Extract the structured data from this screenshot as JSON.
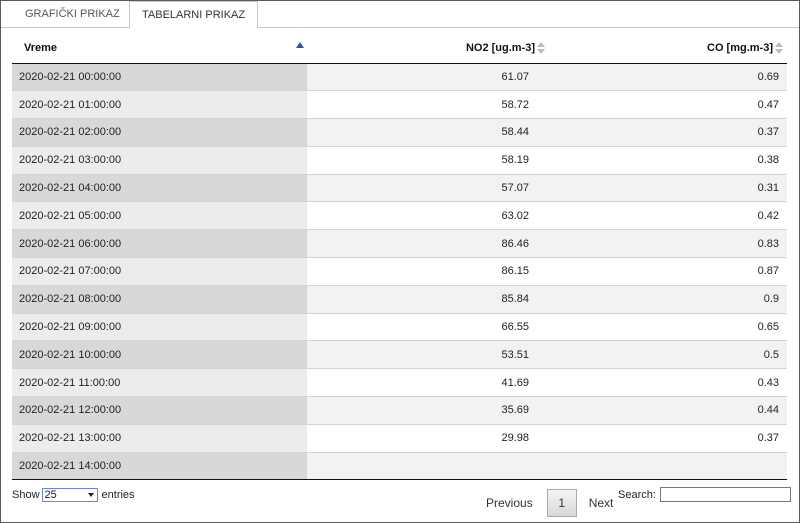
{
  "tabs": [
    {
      "label": "GRAFIČKI PRIKAZ"
    },
    {
      "label": "TABELARNI PRIKAZ"
    }
  ],
  "table": {
    "columns": [
      "Vreme",
      "NO2 [ug.m-3]",
      "CO [mg.m-3]"
    ],
    "rows": [
      [
        "2020-02-21 00:00:00",
        "61.07",
        "0.69"
      ],
      [
        "2020-02-21 01:00:00",
        "58.72",
        "0.47"
      ],
      [
        "2020-02-21 02:00:00",
        "58.44",
        "0.37"
      ],
      [
        "2020-02-21 03:00:00",
        "58.19",
        "0.38"
      ],
      [
        "2020-02-21 04:00:00",
        "57.07",
        "0.31"
      ],
      [
        "2020-02-21 05:00:00",
        "63.02",
        "0.42"
      ],
      [
        "2020-02-21 06:00:00",
        "86.46",
        "0.83"
      ],
      [
        "2020-02-21 07:00:00",
        "86.15",
        "0.87"
      ],
      [
        "2020-02-21 08:00:00",
        "85.84",
        "0.9"
      ],
      [
        "2020-02-21 09:00:00",
        "66.55",
        "0.65"
      ],
      [
        "2020-02-21 10:00:00",
        "53.51",
        "0.5"
      ],
      [
        "2020-02-21 11:00:00",
        "41.69",
        "0.43"
      ],
      [
        "2020-02-21 12:00:00",
        "35.69",
        "0.44"
      ],
      [
        "2020-02-21 13:00:00",
        "29.98",
        "0.37"
      ],
      [
        "2020-02-21 14:00:00",
        "",
        ""
      ]
    ]
  },
  "length": {
    "show_label": "Show",
    "selected": "25",
    "entries_label": "entries"
  },
  "pagination": {
    "previous": "Previous",
    "page": "1",
    "next": "Next"
  },
  "search": {
    "label": "Search:",
    "value": ""
  }
}
